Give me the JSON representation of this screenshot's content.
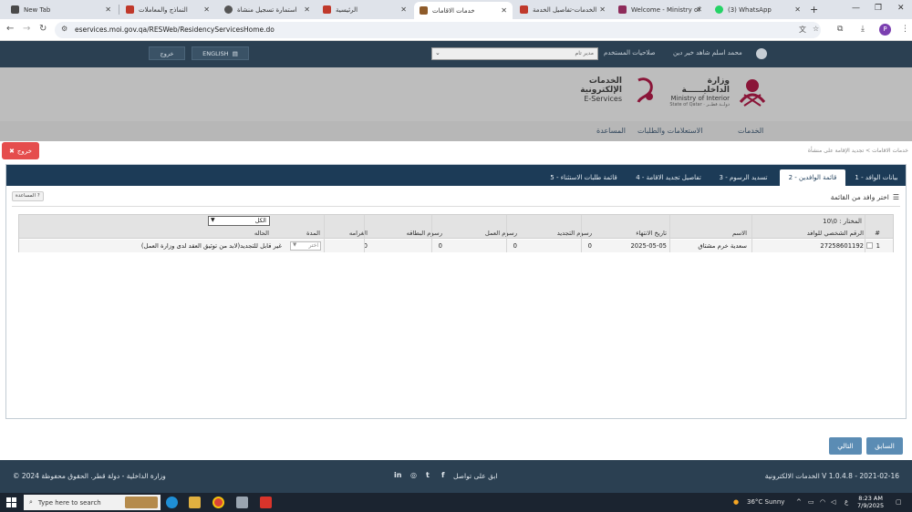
{
  "browser": {
    "tabs": [
      {
        "label": "New Tab",
        "active": false
      },
      {
        "label": "النماذج والمعاملات",
        "active": false
      },
      {
        "label": "استمارة تسجيل منشأة",
        "active": false
      },
      {
        "label": "الرئيسية",
        "active": false
      },
      {
        "label": "خدمات الاقامات",
        "active": true
      },
      {
        "label": "الخدمات-تفاصيل الخدمة",
        "active": false
      },
      {
        "label": "Welcome - Ministry of Int",
        "active": false
      },
      {
        "label": "(3) WhatsApp",
        "active": false
      }
    ],
    "new_tab": "+",
    "url": "eservices.moi.gov.qa/RESWeb/ResidencyServicesHome.do"
  },
  "topbar": {
    "logout_label": "خروج",
    "english_label": "ENGLISH",
    "role_label": "صلاحيات المستخدم",
    "role_value": "مدير تام",
    "user_name": "محمد اسلم شاهد خير دين"
  },
  "header": {
    "eservices_ar": "الخدمات الإلكترونية",
    "eservices_en": "E-Services",
    "moi_ar": "وزارة الداخليــــــة",
    "moi_en": "Ministry of Interior",
    "moi_sub": "State of Qatar · دولــة قطــر"
  },
  "nav": {
    "items": [
      "الخدمات",
      "الاستعلامات والطلبات",
      "المساعدة"
    ]
  },
  "panel": {
    "logout_button": "خروج",
    "breadcrumb": "خدمات الاقامات  >  تجديد الإقامة على منشأة",
    "wizard_tabs": [
      {
        "label": "1 - بيانات الوافد",
        "active": false
      },
      {
        "label": "2 - قائمة الوافدين",
        "active": true
      },
      {
        "label": "3 - تسديد الرسوم",
        "active": false
      },
      {
        "label": "4 - تفاصيل تجديد الاقامة",
        "active": false
      },
      {
        "label": "5 - قائمة طلبات الاستثناء",
        "active": false
      }
    ],
    "help_button": "المساعدة",
    "section_title": "اختر وافد من القائمة",
    "selected_count": "المختار : 0\\10",
    "status_filter": "الكل",
    "columns": {
      "index": "#",
      "personal_no": "الرقم الشخصي للوافد",
      "name": "الاسم",
      "expiry": "تاريخ الانتهاء",
      "renewal_fee": "رسوم التجديد",
      "work_fee": "رسوم العمل",
      "card_fee": "رسوم البطاقه",
      "fine": "الغرامه",
      "duration": "المدة",
      "status": "الحاله"
    },
    "rows": [
      {
        "index": "1",
        "personal_no": "27258601192",
        "name": "سعدية خرم مشتاق",
        "expiry": "2025-05-05",
        "renewal_fee": "0",
        "work_fee": "0",
        "card_fee": "0",
        "fine": "0",
        "duration": "اختر",
        "status": "غير قابل للتجديد(لابد من توثيق العقد لدى وزارة العمل)"
      }
    ],
    "previous_button": "السابق",
    "next_button": "التالي"
  },
  "footer": {
    "version": "الخدمات الالكترونية V 1.0.4.8 - 2021-02-16",
    "follow_us": "ابق على تواصل",
    "copyright": "© 2024 وزارة الداخلية - دولة قطر. الحقوق محفوظة"
  },
  "taskbar": {
    "search_placeholder": "Type here to search",
    "weather": "36°C  Sunny",
    "time": "8:23 AM",
    "date": "7/9/2025"
  }
}
